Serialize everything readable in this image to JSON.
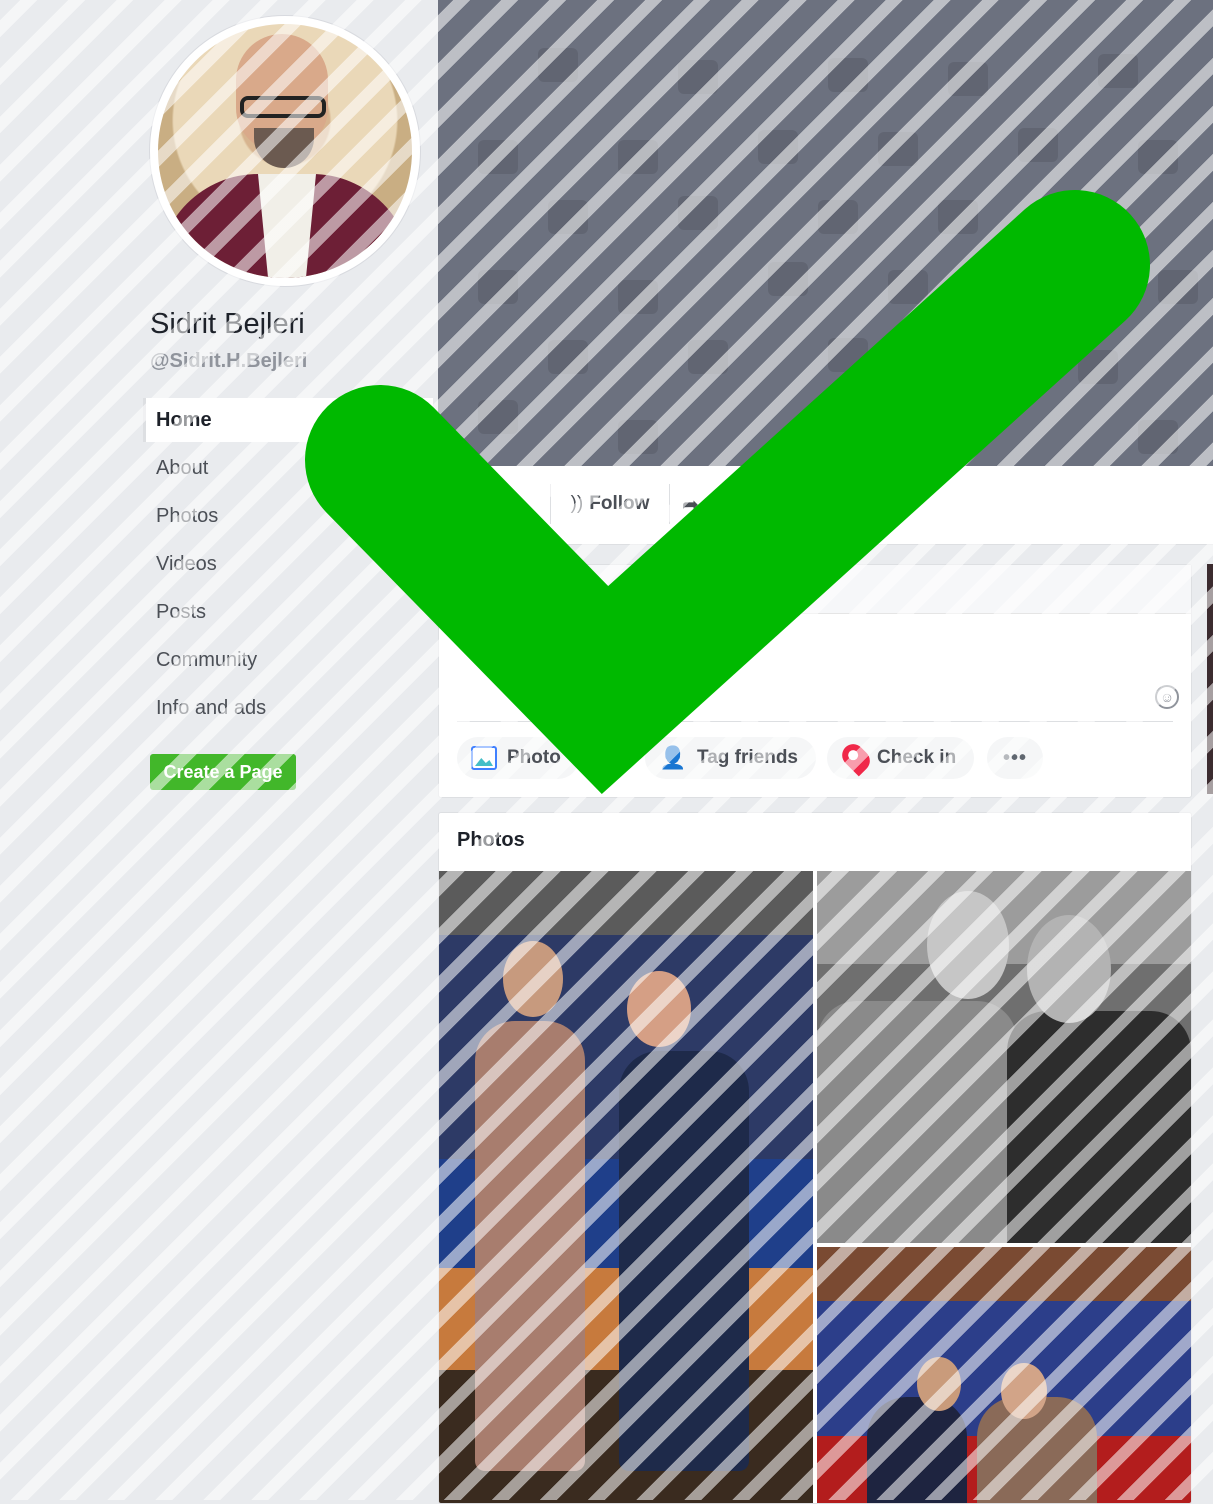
{
  "profile": {
    "name": "Sidrit Bejleri",
    "handle": "@Sidrit.H.Bejleri"
  },
  "nav": {
    "items": [
      {
        "label": "Home",
        "active": true
      },
      {
        "label": "About"
      },
      {
        "label": "Photos"
      },
      {
        "label": "Videos"
      },
      {
        "label": "Posts"
      },
      {
        "label": "Community"
      },
      {
        "label": "Info and ads"
      }
    ],
    "create_page_label": "Create a Page"
  },
  "action_bar": {
    "follow_label": "Follow"
  },
  "composer": {
    "photo_label": "Photo",
    "tag_friends_label": "Tag friends",
    "check_in_label": "Check in",
    "more_label": "•••"
  },
  "photos_section": {
    "title": "Photos"
  },
  "colors": {
    "accent_green": "#42b72a",
    "checkmark_green": "#00b900",
    "cover_gray": "#6c717f",
    "page_bg": "#e9ebee"
  }
}
